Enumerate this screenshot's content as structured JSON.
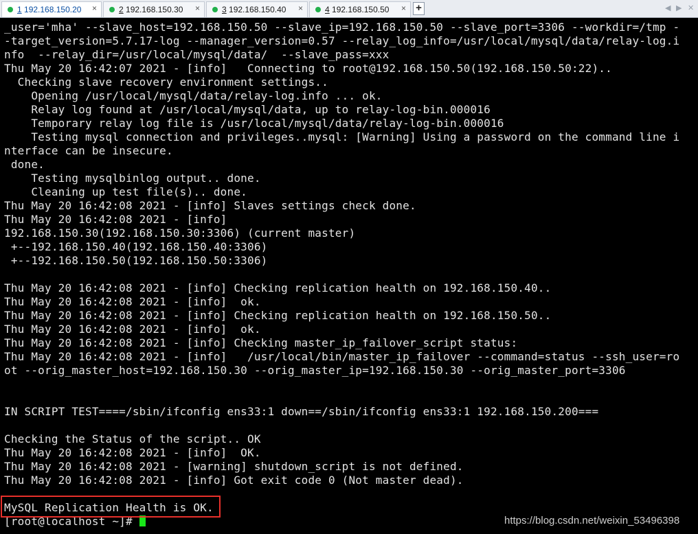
{
  "tabs": [
    {
      "num": "1",
      "host": "192.168.150.20",
      "active": true
    },
    {
      "num": "2",
      "host": "192.168.150.30",
      "active": false
    },
    {
      "num": "3",
      "host": "192.168.150.40",
      "active": false
    },
    {
      "num": "4",
      "host": "192.168.150.50",
      "active": false
    }
  ],
  "tab_close_glyph": "×",
  "new_tab_glyph": "+",
  "nav": {
    "prev": "◀",
    "next": "▶",
    "close": "✕"
  },
  "terminal": {
    "lines": [
      "_user='mha' --slave_host=192.168.150.50 --slave_ip=192.168.150.50 --slave_port=3306 --workdir=/tmp -",
      "-target_version=5.7.17-log --manager_version=0.57 --relay_log_info=/usr/local/mysql/data/relay-log.i",
      "nfo  --relay_dir=/usr/local/mysql/data/  --slave_pass=xxx",
      "Thu May 20 16:42:07 2021 - [info]   Connecting to root@192.168.150.50(192.168.150.50:22)..",
      "  Checking slave recovery environment settings..",
      "    Opening /usr/local/mysql/data/relay-log.info ... ok.",
      "    Relay log found at /usr/local/mysql/data, up to relay-log-bin.000016",
      "    Temporary relay log file is /usr/local/mysql/data/relay-log-bin.000016",
      "    Testing mysql connection and privileges..mysql: [Warning] Using a password on the command line i",
      "nterface can be insecure.",
      " done.",
      "    Testing mysqlbinlog output.. done.",
      "    Cleaning up test file(s).. done.",
      "Thu May 20 16:42:08 2021 - [info] Slaves settings check done.",
      "Thu May 20 16:42:08 2021 - [info]",
      "192.168.150.30(192.168.150.30:3306) (current master)",
      " +--192.168.150.40(192.168.150.40:3306)",
      " +--192.168.150.50(192.168.150.50:3306)",
      "",
      "Thu May 20 16:42:08 2021 - [info] Checking replication health on 192.168.150.40..",
      "Thu May 20 16:42:08 2021 - [info]  ok.",
      "Thu May 20 16:42:08 2021 - [info] Checking replication health on 192.168.150.50..",
      "Thu May 20 16:42:08 2021 - [info]  ok.",
      "Thu May 20 16:42:08 2021 - [info] Checking master_ip_failover_script status:",
      "Thu May 20 16:42:08 2021 - [info]   /usr/local/bin/master_ip_failover --command=status --ssh_user=ro",
      "ot --orig_master_host=192.168.150.30 --orig_master_ip=192.168.150.30 --orig_master_port=3306",
      "",
      "",
      "IN SCRIPT TEST====/sbin/ifconfig ens33:1 down==/sbin/ifconfig ens33:1 192.168.150.200===",
      "",
      "Checking the Status of the script.. OK",
      "Thu May 20 16:42:08 2021 - [info]  OK.",
      "Thu May 20 16:42:08 2021 - [warning] shutdown_script is not defined.",
      "Thu May 20 16:42:08 2021 - [info] Got exit code 0 (Not master dead).",
      "",
      "MySQL Replication Health is OK."
    ],
    "prompt": "[root@localhost ~]# "
  },
  "watermark": "https://blog.csdn.net/weixin_53496398",
  "colors": {
    "highlight_box": "#e8302b",
    "cursor": "#19e619",
    "tab_dot": "#21b04b"
  }
}
